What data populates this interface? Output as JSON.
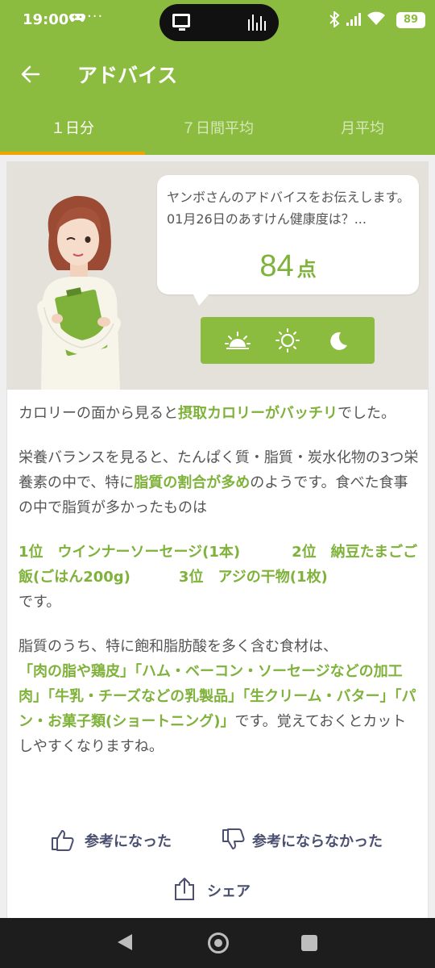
{
  "status_bar": {
    "time": "19:00",
    "battery": "89"
  },
  "app_bar": {
    "title": "アドバイス"
  },
  "tabs": [
    {
      "label": "１日分",
      "active": true
    },
    {
      "label": "７日間平均",
      "active": false
    },
    {
      "label": "月平均",
      "active": false
    }
  ],
  "advice": {
    "bubble_text": "ヤンボさんのアドバイスをお伝えします。01月26日のあすけん健康度は？...",
    "score": "84",
    "score_unit": "点",
    "time_of_day": [
      "sunrise-icon",
      "sun-icon",
      "moon-icon"
    ]
  },
  "content": {
    "p1_a": "カロリーの面から見ると",
    "p1_hl": "摂取カロリーがバッチリ",
    "p1_b": "でした。",
    "p2_a": "栄養バランスを見ると、たんぱく質・脂質・炭水化物の3つ栄養素の中で、特に",
    "p2_hl": "脂質の割合が多め",
    "p2_b": "のようです。食べた食事の中で脂質が多かったものは",
    "rank1": "1位　ウインナーソーセージ(1本)",
    "rank2": "2位　納豆たまごご飯(ごはん200g)",
    "rank3": "3位　アジの干物(1枚)",
    "p3_tail": "です。",
    "p4_a": "脂質のうち、特に飽和脂肪酸を多く含む食材は、",
    "p4_hl": "「肉の脂や鶏皮」「ハム・ベーコン・ソーセージなどの加工肉」「牛乳・チーズなどの乳製品」「生クリーム・バター」「パン・お菓子類(ショートニング)」",
    "p4_b": "です。覚えておくとカットしやすくなりますね。"
  },
  "actions": {
    "helpful": "参考になった",
    "not_helpful": "参考にならなかった",
    "share": "シェア"
  },
  "colors": {
    "brand_green": "#8bbb3f",
    "highlight_green": "#7fb23a",
    "tab_indicator": "#f0a400"
  }
}
